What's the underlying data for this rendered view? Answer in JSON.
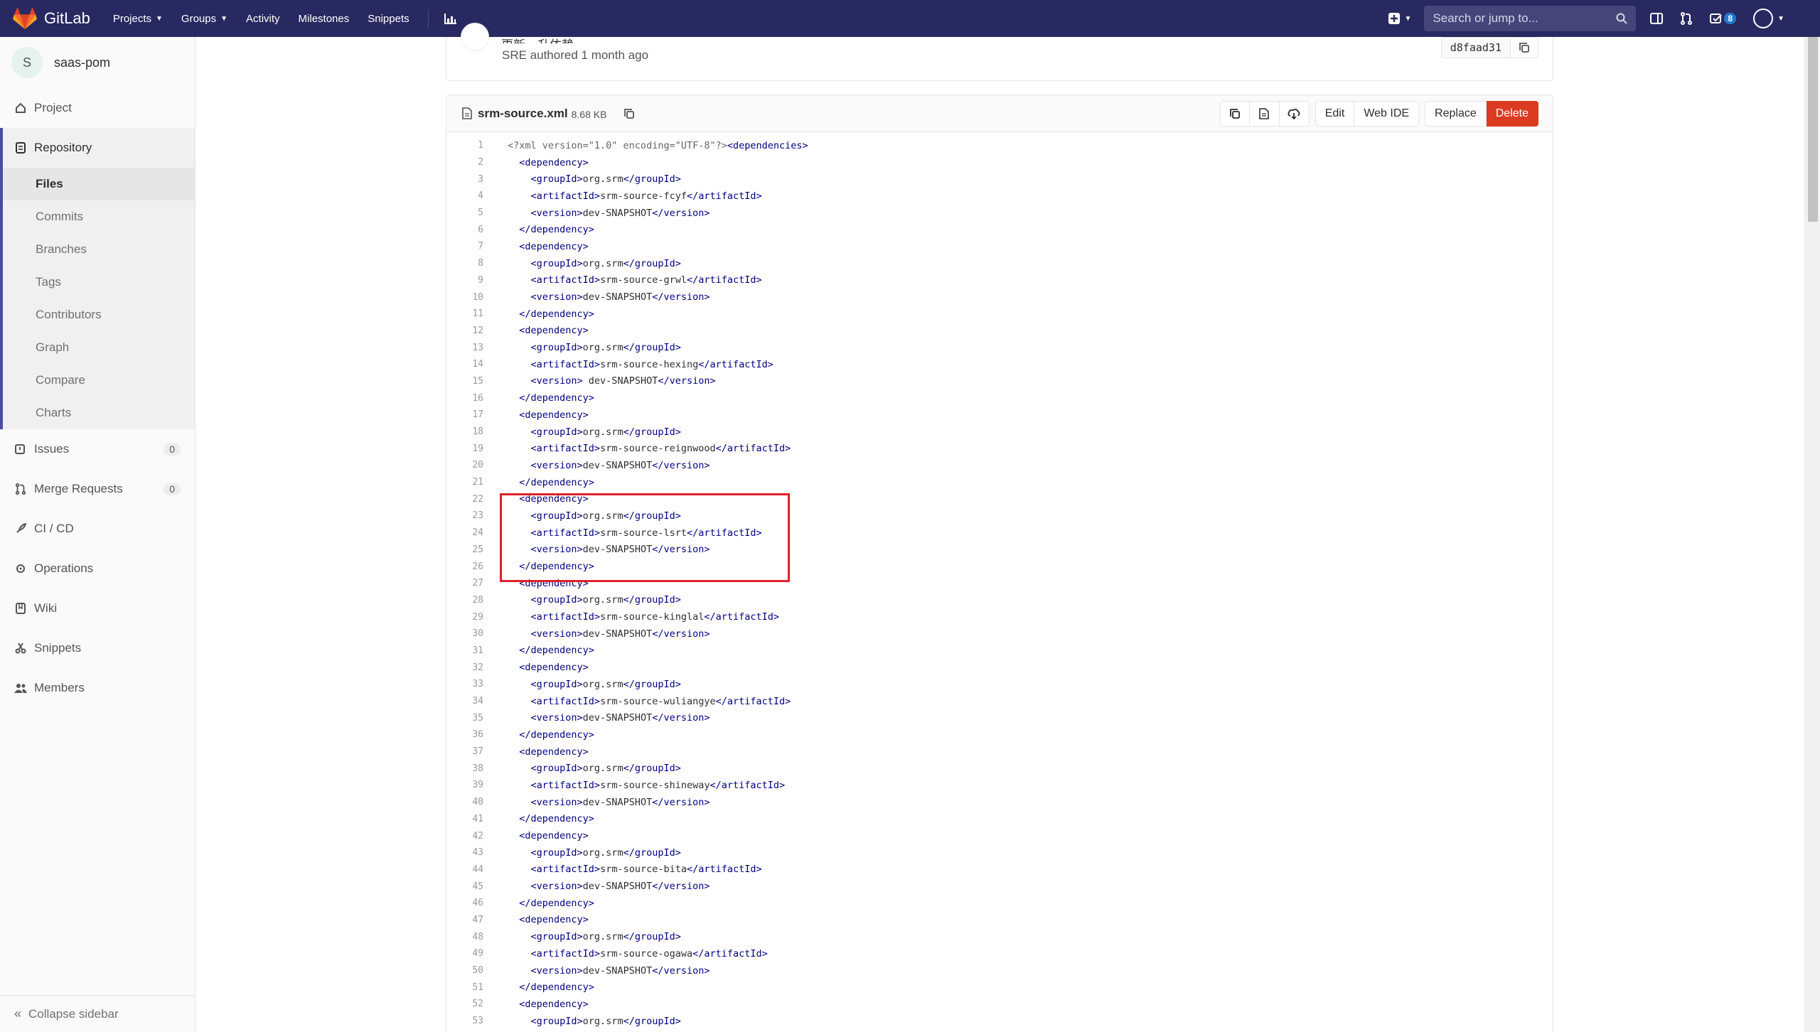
{
  "navbar": {
    "brand": "GitLab",
    "links": [
      "Projects",
      "Groups",
      "Activity",
      "Milestones",
      "Snippets"
    ],
    "search_placeholder": "Search or jump to...",
    "todo_count": "8",
    "bg_color": "#292961"
  },
  "sidebar": {
    "project_initial": "S",
    "project_name": "saas-pom",
    "project_label": "Project",
    "repository_label": "Repository",
    "repo_items": [
      "Files",
      "Commits",
      "Branches",
      "Tags",
      "Contributors",
      "Graph",
      "Compare",
      "Charts"
    ],
    "issues_label": "Issues",
    "issues_count": "0",
    "mr_label": "Merge Requests",
    "mr_count": "0",
    "cicd_label": "CI / CD",
    "operations_label": "Operations",
    "wiki_label": "Wiki",
    "snippets_label": "Snippets",
    "members_label": "Members",
    "collapse_label": "Collapse sidebar"
  },
  "commit": {
    "title": "更新一升依赖",
    "author_line": "SRE authored 1 month ago",
    "sha": "d8faad31"
  },
  "file": {
    "name": "srm-source.xml",
    "size": "8.68 KB",
    "actions": {
      "edit": "Edit",
      "web_ide": "Web IDE",
      "replace": "Replace",
      "delete": "Delete"
    },
    "lines": [
      "<?xml version=\"1.0\" encoding=\"UTF-8\"?><dependencies>",
      "  <dependency>",
      "    <groupId>org.srm</groupId>",
      "    <artifactId>srm-source-fcyf</artifactId>",
      "    <version>dev-SNAPSHOT</version>",
      "  </dependency>",
      "  <dependency>",
      "    <groupId>org.srm</groupId>",
      "    <artifactId>srm-source-grwl</artifactId>",
      "    <version>dev-SNAPSHOT</version>",
      "  </dependency>",
      "  <dependency>",
      "    <groupId>org.srm</groupId>",
      "    <artifactId>srm-source-hexing</artifactId>",
      "    <version> dev-SNAPSHOT</version>",
      "  </dependency>",
      "  <dependency>",
      "    <groupId>org.srm</groupId>",
      "    <artifactId>srm-source-reignwood</artifactId>",
      "    <version>dev-SNAPSHOT</version>",
      "  </dependency>",
      "  <dependency>",
      "    <groupId>org.srm</groupId>",
      "    <artifactId>srm-source-lsrt</artifactId>",
      "    <version>dev-SNAPSHOT</version>",
      "  </dependency>",
      "  <dependency>",
      "    <groupId>org.srm</groupId>",
      "    <artifactId>srm-source-kinglal</artifactId>",
      "    <version>dev-SNAPSHOT</version>",
      "  </dependency>",
      "  <dependency>",
      "    <groupId>org.srm</groupId>",
      "    <artifactId>srm-source-wuliangye</artifactId>",
      "    <version>dev-SNAPSHOT</version>",
      "  </dependency>",
      "  <dependency>",
      "    <groupId>org.srm</groupId>",
      "    <artifactId>srm-source-shineway</artifactId>",
      "    <version>dev-SNAPSHOT</version>",
      "  </dependency>",
      "  <dependency>",
      "    <groupId>org.srm</groupId>",
      "    <artifactId>srm-source-bita</artifactId>",
      "    <version>dev-SNAPSHOT</version>",
      "  </dependency>",
      "  <dependency>",
      "    <groupId>org.srm</groupId>",
      "    <artifactId>srm-source-ogawa</artifactId>",
      "    <version>dev-SNAPSHOT</version>",
      "  </dependency>",
      "  <dependency>",
      "    <groupId>org.srm</groupId>"
    ]
  },
  "annotation": {
    "color": "#e0202a"
  }
}
